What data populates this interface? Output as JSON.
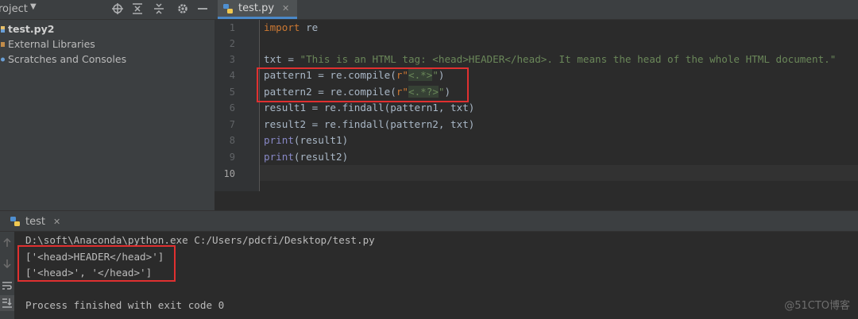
{
  "project_panel": {
    "title": "roject",
    "tree": [
      {
        "label": "test.py2"
      },
      {
        "label": "External Libraries"
      },
      {
        "label": "Scratches and Consoles"
      }
    ]
  },
  "editor": {
    "tab_label": "test.py",
    "tab_close": "✕",
    "line_numbers": [
      "1",
      "2",
      "3",
      "4",
      "5",
      "6",
      "7",
      "8",
      "9",
      "10"
    ],
    "current_line": "10",
    "code": {
      "l1_kw": "import",
      "l1_rest": " re",
      "l3_a": "txt = ",
      "l3_str": "\"This is an HTML tag: <head>HEADER</head>. It means the head of the whole HTML document.\"",
      "l4_a": "pattern1 = re.compile(",
      "l4_str": "r\"",
      "l4_rx": "<.*>",
      "l4_end_str": "\"",
      "l4_close": ")",
      "l5_a": "pattern2 = re.compile(",
      "l5_str": "r\"",
      "l5_rx": "<.*?>",
      "l5_end_str": "\"",
      "l5_close": ")",
      "l6": "result1 = re.findall(pattern1, txt)",
      "l7": "result2 = re.findall(pattern2, txt)",
      "l8_bi": "print",
      "l8_rest": "(result1)",
      "l9_bi": "print",
      "l9_rest": "(result2)"
    }
  },
  "run_panel": {
    "tab_label": "test",
    "tab_close": "✕",
    "console": {
      "command": "D:\\soft\\Anaconda\\python.exe C:/Users/pdcfi/Desktop/test.py",
      "out1": "['<head>HEADER</head>']",
      "out2": "['<head>', '</head>']",
      "exit": "Process finished with exit code 0"
    }
  },
  "watermark": "@51CTO博客",
  "colors": {
    "keyword": "#cc7832",
    "string": "#6a8759",
    "builtin": "#8888c6",
    "highlight_box": "#e03030"
  },
  "icons": [
    "dropdown-arrow-icon",
    "locate-icon",
    "expand-all-icon",
    "collapse-all-icon",
    "gear-icon",
    "minimize-icon",
    "python-file-icon",
    "close-icon",
    "rerun-up-icon",
    "rerun-down-icon",
    "soft-wrap-icon",
    "scroll-to-end-icon"
  ]
}
